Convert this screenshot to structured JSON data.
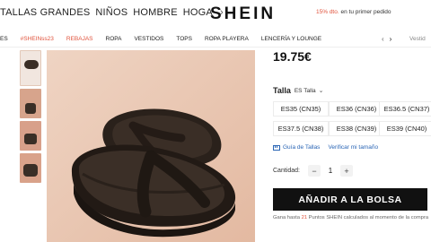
{
  "header": {
    "nav": [
      "TALLAS GRANDES",
      "NIÑOS",
      "HOMBRE",
      "HOGA"
    ],
    "logo": "SHEIN",
    "promo_pct": "15% dto.",
    "promo_text": " en tu primer pedido"
  },
  "categories": {
    "items": [
      {
        "label": "ES",
        "color": "default"
      },
      {
        "label": "#SHEINss23",
        "color": "red"
      },
      {
        "label": "REBAJAS",
        "color": "red"
      },
      {
        "label": "ROPA",
        "color": "default"
      },
      {
        "label": "VESTIDOS",
        "color": "default"
      },
      {
        "label": "TOPS",
        "color": "default"
      },
      {
        "label": "ROPA PLAYERA",
        "color": "default"
      },
      {
        "label": "LENCERÍA Y LOUNGE",
        "color": "default"
      }
    ],
    "search_placeholder": "Vestid"
  },
  "product": {
    "price": "19.75€",
    "size_label": "Talla",
    "size_system": "ES Talla",
    "sizes": [
      "ES35 (CN35)",
      "ES36 (CN36)",
      "ES36.5 (CN37)",
      "ES37.5 (CN38)",
      "ES38 (CN39)",
      "ES39 (CN40)"
    ],
    "size_guide": "Guía de Tallas",
    "fit_check": "Verificar mi tamaño",
    "quantity_label": "Cantidad:",
    "quantity": "1",
    "add_to_bag": "AÑADIR A LA BOLSA",
    "points_prefix": "Gana hasta ",
    "points_value": "21",
    "points_suffix": " Puntos SHEIN calculados al momento de la compra"
  },
  "colors": {
    "accent": "#e0523b",
    "link": "#2a65b5",
    "button": "#111111",
    "image_bg": "#e9c9b5",
    "sandal": "#2f261f"
  }
}
